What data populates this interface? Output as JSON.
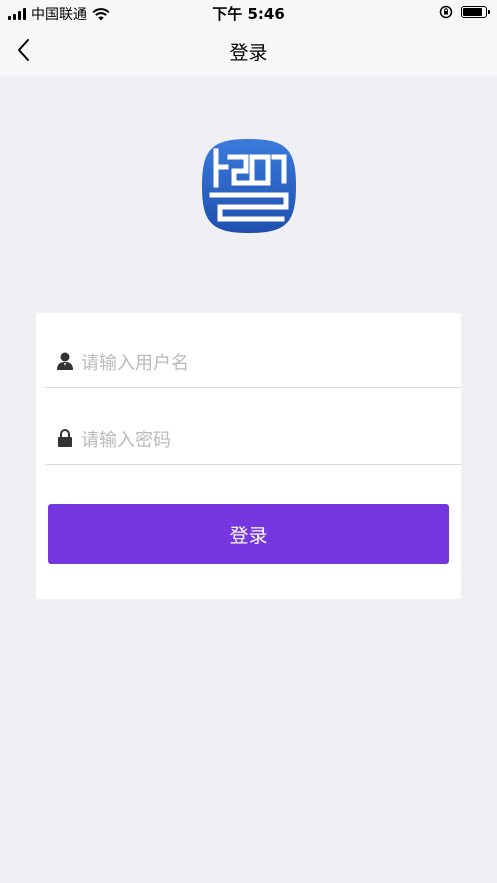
{
  "status_bar": {
    "carrier": "中国联通",
    "time": "下午 5:46"
  },
  "nav": {
    "title": "登录",
    "back_icon": "chevron-left-icon"
  },
  "form": {
    "username_placeholder": "请输入用户名",
    "username_icon": "user-icon",
    "password_placeholder": "请输入密码",
    "password_icon": "lock-icon",
    "login_label": "登录"
  },
  "colors": {
    "accent": "#7536e0",
    "logo_blue": "#2c6ad0",
    "background": "#efeff4"
  }
}
